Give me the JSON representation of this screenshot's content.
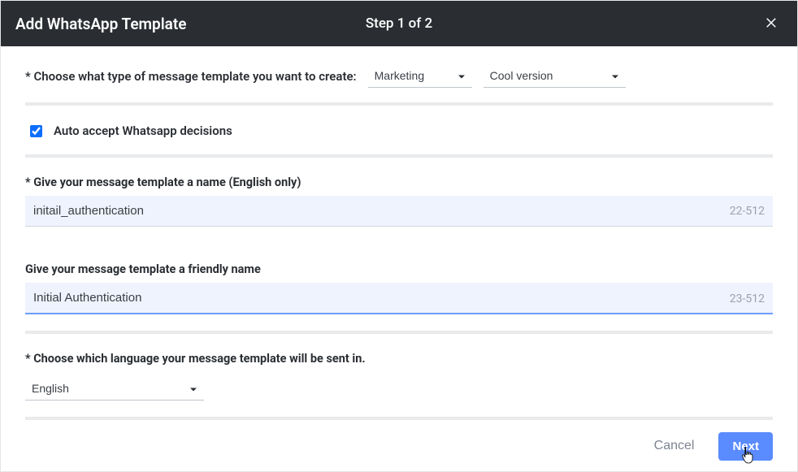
{
  "header": {
    "title": "Add WhatsApp Template",
    "step": "Step 1 of 2"
  },
  "type_row": {
    "label": "* Choose what type of message template you want to create:",
    "type_value": "Marketing",
    "variant_value": "Cool version"
  },
  "auto_accept": {
    "label": "Auto accept Whatsapp decisions",
    "checked": true
  },
  "template_name": {
    "label": "* Give your message template a name (English only)",
    "value": "initail_authentication",
    "counter": "22-512"
  },
  "friendly_name": {
    "label": "Give your message template a friendly name",
    "value": "Initial Authentication",
    "counter": "23-512"
  },
  "language": {
    "label": "* Choose which language your message template will be sent in.",
    "value": "English"
  },
  "footer": {
    "cancel": "Cancel",
    "next": "Next"
  }
}
